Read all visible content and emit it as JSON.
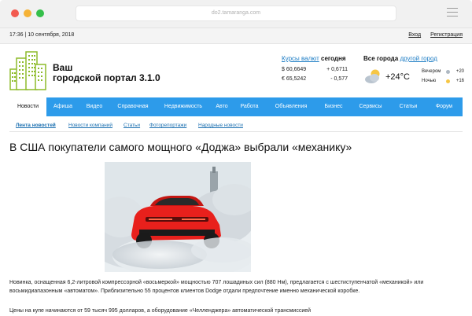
{
  "browser": {
    "url": "do2.tamaranga.com"
  },
  "topbar": {
    "datetime": "17:36 | 10 сентября, 2018",
    "login": "Вход",
    "register": "Регистрация"
  },
  "header": {
    "site_name_line1": "Ваш",
    "site_name_line2": "городской портал 3.1.0"
  },
  "currency": {
    "link_label": "Курсы валют",
    "today_label": "сегодня",
    "rates": [
      {
        "value": "$ 60,6649",
        "change": "+ 0,6711"
      },
      {
        "value": "€ 65,5242",
        "change": "- 0,577"
      }
    ]
  },
  "weather": {
    "all_cities": "Все города",
    "other_city": "другой город",
    "icon": "partly-cloudy-icon",
    "temperature": "+24°C",
    "evening_label": "Вечером",
    "evening_temp": "+20",
    "night_label": "Ночью",
    "night_temp": "+16"
  },
  "nav": {
    "items": [
      "Новости",
      "Афиша",
      "Видео",
      "Справочная",
      "Недвижимость",
      "Авто",
      "Работа",
      "Объявления",
      "Бизнес",
      "Сервисы",
      "Статьи",
      "Форум"
    ],
    "active_index": 0
  },
  "subnav": {
    "items": [
      "Лента новостей",
      "Новости компаний",
      "Статьи",
      "Фоторепортажи",
      "Народные новости"
    ]
  },
  "article": {
    "title": "В США покупатели самого мощного «Доджа» выбрали «механику»",
    "image_alt": "red sports car with smoke",
    "paragraph1": "Новинка, оснащенная 6,2-литровой компрессорной «восьмеркой» мощностью 707 лошадиных сил (880 Нм), предлагается с шестиступенчатой «механикой» или восьмидиапазонным «автоматом». Приблизительно 55 процентов клиентов Dodge отдали предпочтение именно механической коробке.",
    "paragraph2": "Цены на купе начинаются от 59 тысяч 995 долларов, а оборудование «Челленджера» автоматической трансмиссией"
  },
  "colors": {
    "nav_blue": "#2d9bea",
    "link_blue": "#1a7bc4",
    "car_red": "#e8201c"
  }
}
